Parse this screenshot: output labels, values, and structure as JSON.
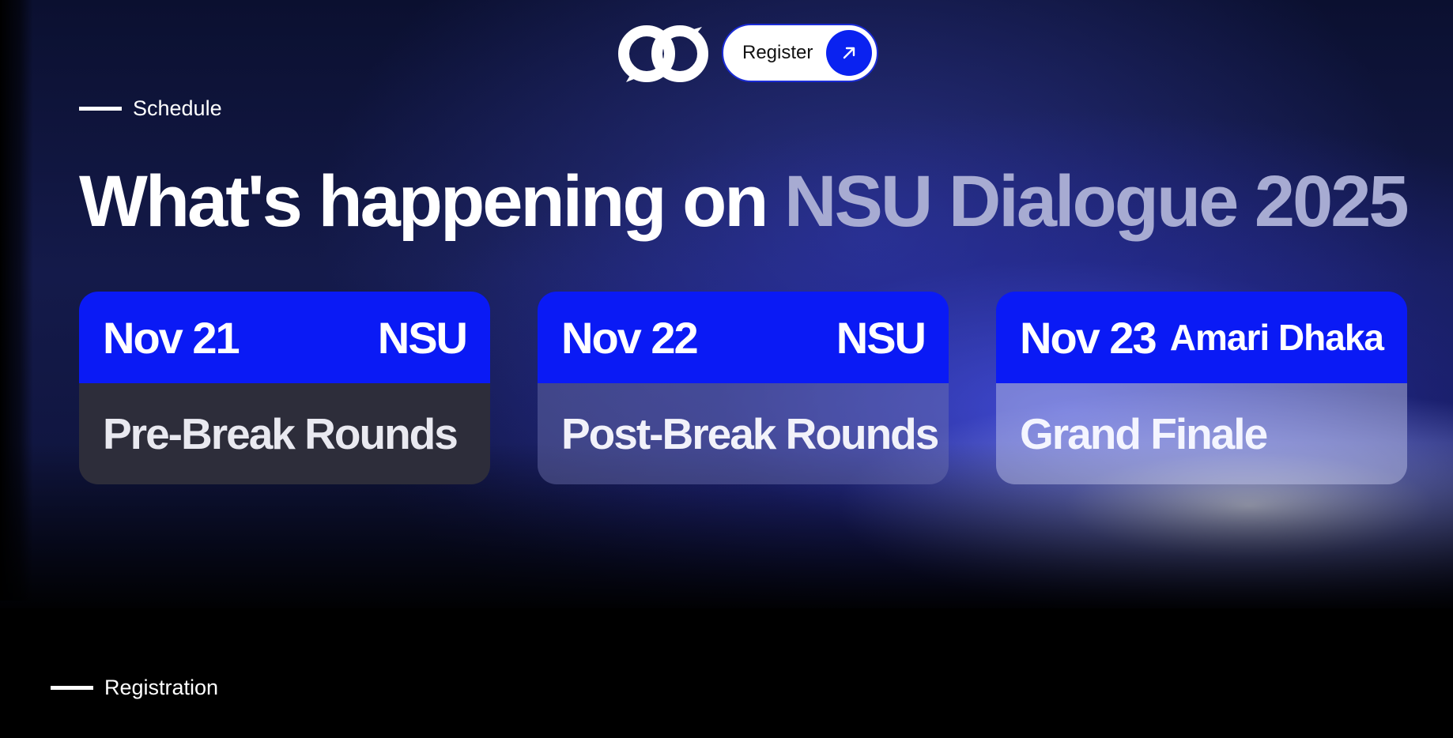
{
  "header": {
    "register_label": "Register"
  },
  "schedule": {
    "label": "Schedule",
    "heading_main": "What's happening on ",
    "heading_accent": "NSU Dialogue 2025",
    "events": [
      {
        "date": "Nov 21",
        "venue": "NSU",
        "title": "Pre-Break Rounds"
      },
      {
        "date": "Nov 22",
        "venue": "NSU",
        "title": "Post-Break Rounds"
      },
      {
        "date": "Nov 23",
        "venue": "Amari Dhaka",
        "title": "Grand Finale"
      }
    ]
  },
  "registration": {
    "label": "Registration"
  },
  "colors": {
    "accent_blue": "#0a1af5",
    "heading_accent": "#a7abd2",
    "background": "#000000"
  },
  "icons": {
    "logo": "interlocked-rings-logo",
    "register_arrow": "arrow-up-right-icon"
  }
}
